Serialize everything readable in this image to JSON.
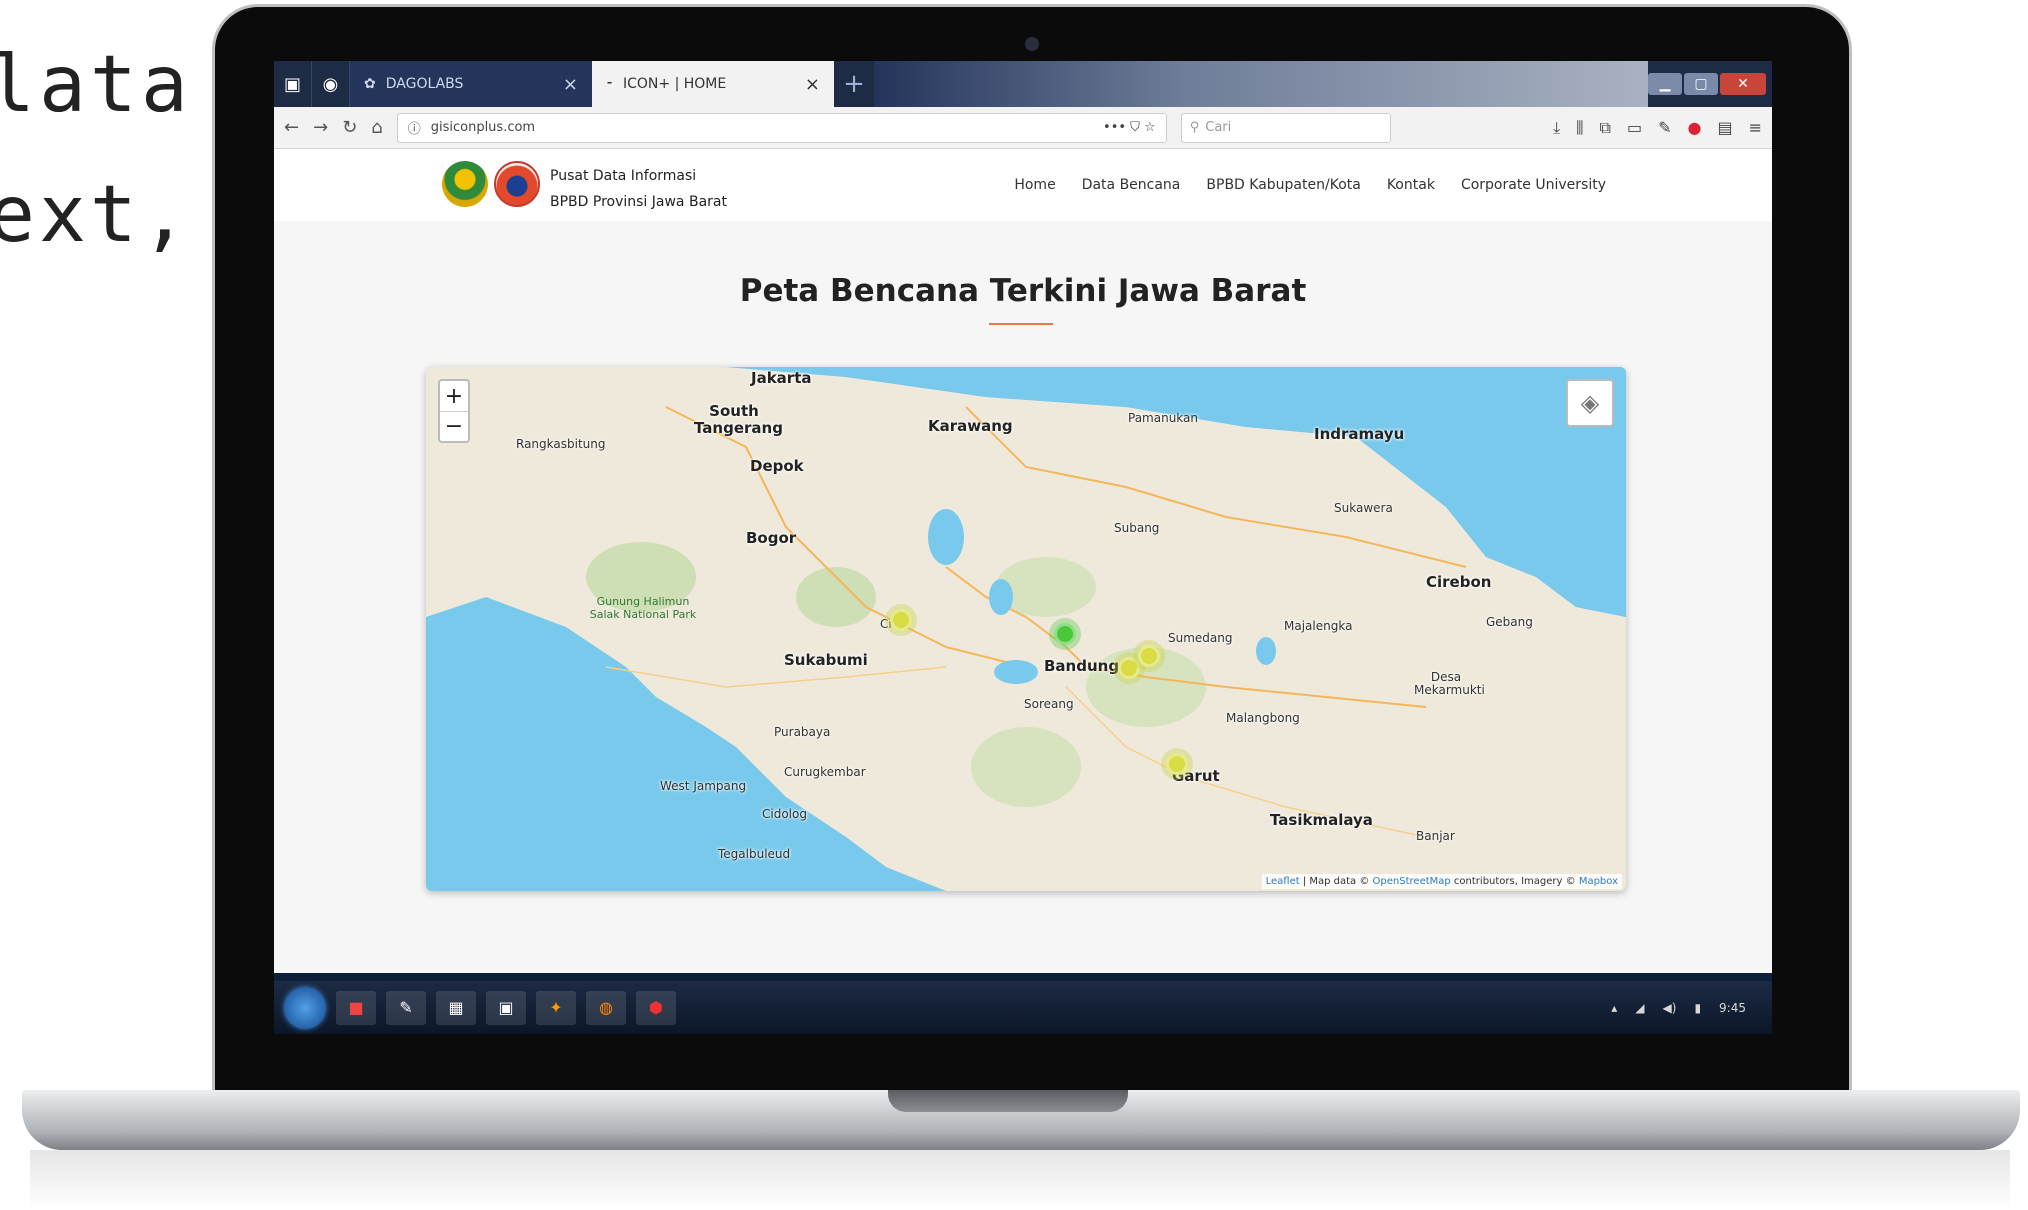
{
  "background_text": {
    "line1": "lata",
    "line2": "ext,"
  },
  "browser": {
    "tabs": [
      {
        "title": "DAGOLABS",
        "close": "×"
      },
      {
        "title": "ICON+ | HOME",
        "close": "×"
      }
    ],
    "new_tab": "+",
    "url": "gisiconplus.com",
    "search_placeholder": "Cari",
    "page_actions": "••• ⛉ ☆"
  },
  "site": {
    "org_line1": "Pusat Data Informasi",
    "org_line2": "BPBD Provinsi Jawa Barat",
    "menu": [
      "Home",
      "Data Bencana",
      "BPBD Kabupaten/Kota",
      "Kontak",
      "Corporate University"
    ],
    "title": "Peta Bencana Terkini Jawa Barat"
  },
  "map": {
    "zoom_in": "+",
    "zoom_out": "−",
    "cities": [
      "Jakarta",
      "South Tangerang",
      "Depok",
      "Bogor",
      "Karawang",
      "Indramayu",
      "Cirebon",
      "Bandung",
      "Sukabumi",
      "Garut",
      "Tasikmalaya"
    ],
    "towns": [
      "Rangkasbitung",
      "Pamanukan",
      "Sukawera",
      "Subang",
      "Sumedang",
      "Majalengka",
      "Gebang",
      "Desa Mekarmukti",
      "Soreang",
      "Malangbong",
      "Purabaya",
      "Curugkembar",
      "West Jampang",
      "Cidolog",
      "Tegalbuleud",
      "Banjar",
      "Ci"
    ],
    "park": "Gunung Halimun Salak National Park",
    "attribution": {
      "leaflet": "Leaflet",
      "text1": " | Map data © ",
      "osm": "OpenStreetMap",
      "text2": " contributors, Imagery © ",
      "mapbox": "Mapbox"
    },
    "colors": {
      "water": "#78c9ec",
      "land": "#efe9dc",
      "marker_yellow": "#d9dd43",
      "marker_green": "#49c93a"
    }
  },
  "taskbar": {
    "clock": "9:45"
  }
}
